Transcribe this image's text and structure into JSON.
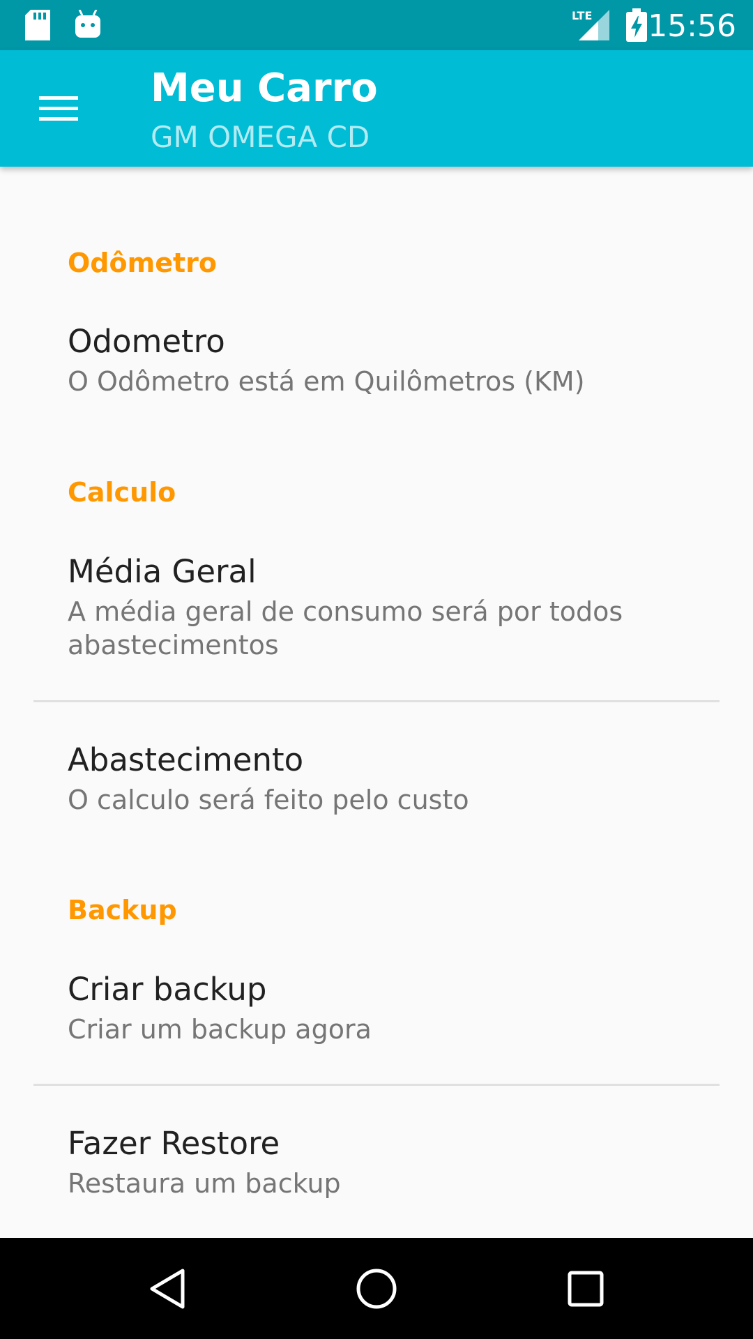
{
  "status_bar": {
    "time": "15:56",
    "icons": [
      "sd-card-icon",
      "android-icon",
      "lte-signal-icon",
      "battery-charging-icon"
    ],
    "network_label": "LTE"
  },
  "app_bar": {
    "title": "Meu Carro",
    "subtitle": "GM OMEGA CD",
    "menu_icon": "menu-icon",
    "color": "#00bcd4"
  },
  "settings": {
    "sections": [
      {
        "header": "Odômetro",
        "items": [
          {
            "title": "Odometro",
            "summary": "O Odômetro está em Quilômetros (KM)"
          }
        ]
      },
      {
        "header": "Calculo",
        "items": [
          {
            "title": "Média Geral",
            "summary": "A média geral de consumo será por todos abastecimentos"
          },
          {
            "title": "Abastecimento",
            "summary": "O calculo será feito pelo custo"
          }
        ]
      },
      {
        "header": "Backup",
        "items": [
          {
            "title": "Criar backup",
            "summary": "Criar um backup agora"
          },
          {
            "title": "Fazer Restore",
            "summary": "Restaura um backup"
          }
        ]
      }
    ],
    "accent_color": "#ff9800"
  },
  "nav_bar": {
    "buttons": [
      "back-icon",
      "home-icon",
      "recents-icon"
    ]
  }
}
